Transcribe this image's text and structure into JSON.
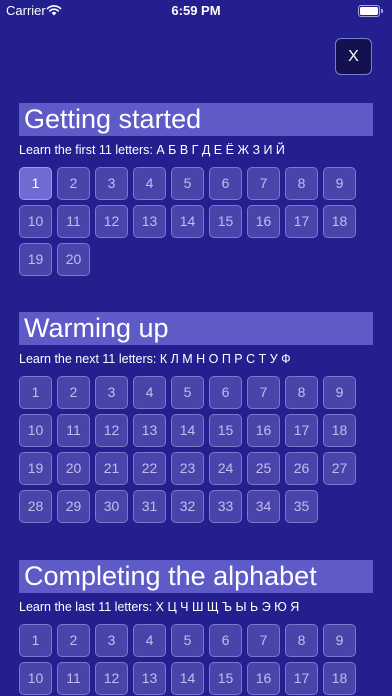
{
  "status_bar": {
    "carrier": "Carrier",
    "time": "6:59 PM"
  },
  "close_button": {
    "label": "X"
  },
  "colors": {
    "background": "#241f8f",
    "title_band": "#5e5ac8",
    "active_level": "#6e6bd2"
  },
  "sections": [
    {
      "title": "Getting started",
      "description": "Learn the first 11 letters: А Б В Г Д Е Ё Ж З И Й",
      "levels": [
        "1",
        "2",
        "3",
        "4",
        "5",
        "6",
        "7",
        "8",
        "9",
        "10",
        "11",
        "12",
        "13",
        "14",
        "15",
        "16",
        "17",
        "18",
        "19",
        "20"
      ],
      "active_level": "1"
    },
    {
      "title": "Warming up",
      "description": "Learn the next 11 letters: К Л М Н О П Р С Т У Ф",
      "levels": [
        "1",
        "2",
        "3",
        "4",
        "5",
        "6",
        "7",
        "8",
        "9",
        "10",
        "11",
        "12",
        "13",
        "14",
        "15",
        "16",
        "17",
        "18",
        "19",
        "20",
        "21",
        "22",
        "23",
        "24",
        "25",
        "26",
        "27",
        "28",
        "29",
        "30",
        "31",
        "32",
        "33",
        "34",
        "35"
      ],
      "active_level": ""
    },
    {
      "title": "Completing the alphabet",
      "description": "Learn the last 11 letters: Х Ц Ч Ш Щ Ъ Ы Ь Э Ю Я",
      "levels": [
        "1",
        "2",
        "3",
        "4",
        "5",
        "6",
        "7",
        "8",
        "9",
        "10",
        "11",
        "12",
        "13",
        "14",
        "15",
        "16",
        "17",
        "18"
      ],
      "active_level": ""
    }
  ]
}
